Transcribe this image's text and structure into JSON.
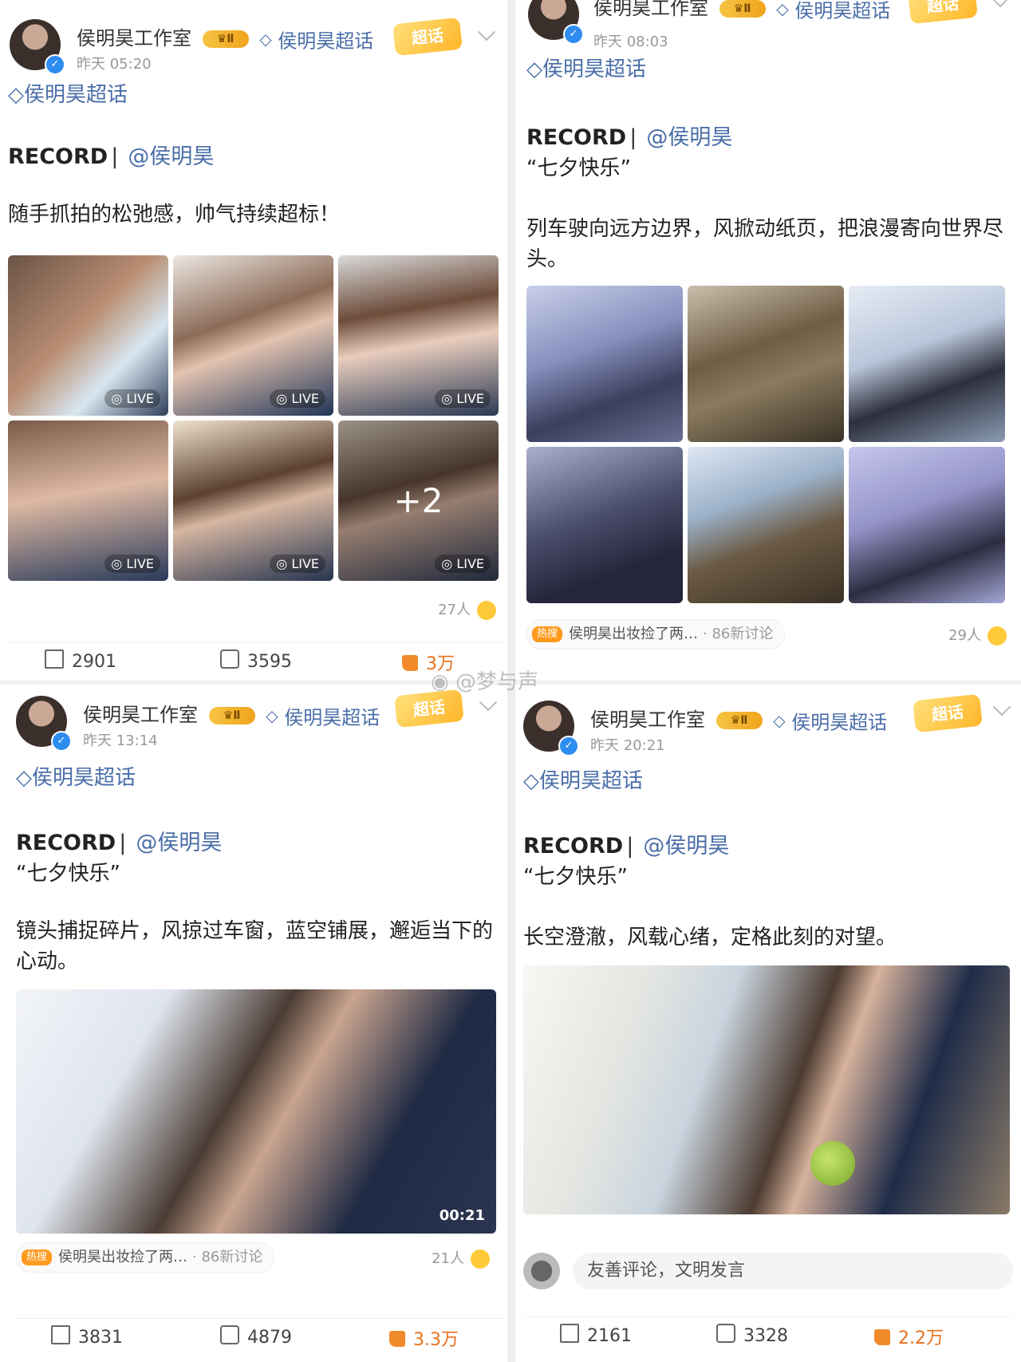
{
  "posts": [
    {
      "author": "侯明昊工作室",
      "level": "Ⅱ",
      "super_topic": "侯明昊超话",
      "badge": "超话",
      "time": "昨天 05:20",
      "topic_line": "侯明昊超话",
      "record": "RECORD",
      "mention": "@侯明昊",
      "subtitle": "",
      "content": "随手抓拍的松弛感，帅气持续超标！",
      "live_label": "LIVE",
      "more_count": "+2",
      "likers": "27人",
      "actions": {
        "share": "2901",
        "comment": "3595",
        "like": "3万"
      }
    },
    {
      "author": "侯明昊工作室",
      "level": "Ⅱ",
      "super_topic": "侯明昊超话",
      "badge": "超话",
      "time": "昨天 08:03",
      "topic_line": "侯明昊超话",
      "record": "RECORD",
      "mention": "@侯明昊",
      "subtitle": "“七夕快乐”",
      "content": "列车驶向远方边界，风掀动纸页，把浪漫寄向世界尽头。",
      "hot_tag": "热搜",
      "hot_text": "侯明昊出妆捡了两…",
      "hot_count": "· 86新讨论",
      "likers": "29人"
    },
    {
      "author": "侯明昊工作室",
      "level": "Ⅱ",
      "super_topic": "侯明昊超话",
      "badge": "超话",
      "time": "昨天 13:14",
      "topic_line": "侯明昊超话",
      "record": "RECORD",
      "mention": "@侯明昊",
      "subtitle": "“七夕快乐”",
      "content": "镜头捕捉碎片，风掠过车窗，蓝空铺展，邂逅当下的心动。",
      "duration": "00:21",
      "hot_tag": "热搜",
      "hot_text": "侯明昊出妆捡了两…",
      "hot_count": "· 86新讨论",
      "likers": "21人",
      "actions": {
        "share": "3831",
        "comment": "4879",
        "like": "3.3万"
      }
    },
    {
      "author": "侯明昊工作室",
      "level": "Ⅱ",
      "super_topic": "侯明昊超话",
      "badge": "超话",
      "time": "昨天 20:21",
      "topic_line": "侯明昊超话",
      "record": "RECORD",
      "mention": "@侯明昊",
      "subtitle": "“七夕快乐”",
      "content": "长空澄澈，风载心绪，定格此刻的对望。",
      "comment_placeholder": "友善评论，文明发言",
      "actions": {
        "share": "2161",
        "comment": "3328",
        "like": "2.2万"
      }
    }
  ],
  "watermark": "@梦与声",
  "colors": {
    "link": "#4a6ea8",
    "like": "#e8711c",
    "badge": "#ffb629"
  }
}
